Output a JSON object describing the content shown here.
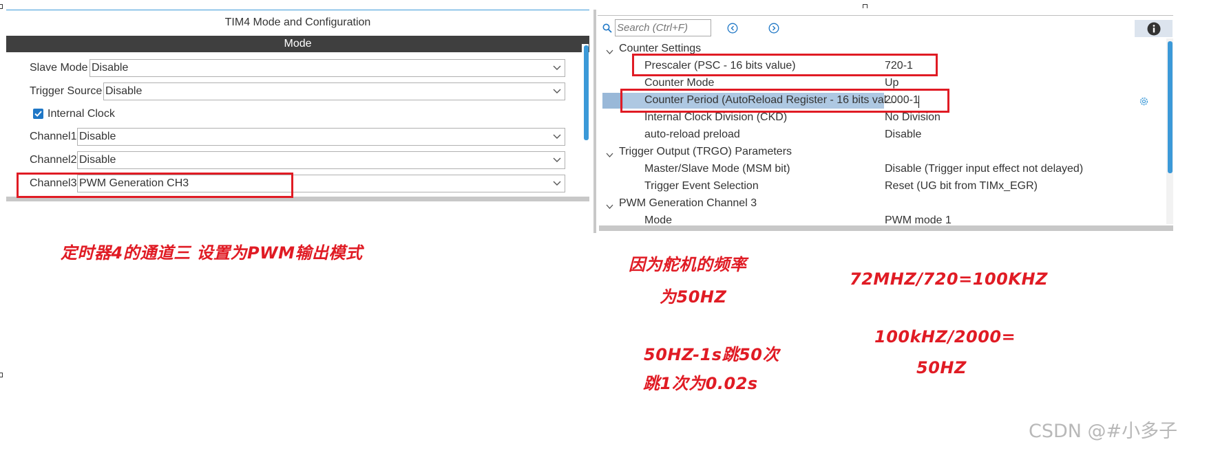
{
  "left_panel": {
    "title": "TIM4 Mode and Configuration",
    "mode_header": "Mode",
    "rows": [
      {
        "label": "Slave Mode",
        "value": "Disable"
      },
      {
        "label": "Trigger Source",
        "value": "Disable"
      },
      {
        "label": "Channel1",
        "value": "Disable"
      },
      {
        "label": "Channel2",
        "value": "Disable"
      },
      {
        "label": "Channel3",
        "value": "PWM Generation CH3"
      }
    ],
    "internal_clock": {
      "label": "Internal Clock",
      "checked": true
    }
  },
  "right_panel": {
    "search_placeholder": "Search (Ctrl+F)",
    "groups": [
      {
        "label": "Counter Settings"
      },
      {
        "label": "Trigger Output (TRGO) Parameters"
      },
      {
        "label": "PWM Generation Channel 3"
      }
    ],
    "params": [
      {
        "label": "Prescaler (PSC - 16 bits value)",
        "value": "720-1"
      },
      {
        "label": "Counter Mode",
        "value": "Up"
      },
      {
        "label": "Counter Period (AutoReload Register - 16 bits val...",
        "value": "2000-1"
      },
      {
        "label": "Internal Clock Division (CKD)",
        "value": "No Division"
      },
      {
        "label": "auto-reload preload",
        "value": "Disable"
      },
      {
        "label": "Master/Slave Mode (MSM bit)",
        "value": "Disable (Trigger input effect not delayed)"
      },
      {
        "label": "Trigger Event Selection",
        "value": "Reset (UG bit from TIMx_EGR)"
      },
      {
        "label": "Mode",
        "value": "PWM mode 1"
      }
    ],
    "selected_param_index": 2
  },
  "annotations": {
    "left_note": "定时器4的通道三  设置为PWM输出模式",
    "freq_line1": "因为舵机的频率",
    "freq_line2": "为50HZ",
    "calc1": "72MHZ/720=100KHZ",
    "period_line1": "50HZ-1s跳50次",
    "period_line2": "跳1次为0.02s",
    "calc2_line1": "100kHZ/2000=",
    "calc2_line2": "50HZ"
  },
  "watermark": "CSDN @#小多子",
  "colors": {
    "accent": "#3b99d8",
    "annotation_red": "#e01b24",
    "mode_bar": "#3f3f3f",
    "selected_row": "#aec8e2"
  }
}
